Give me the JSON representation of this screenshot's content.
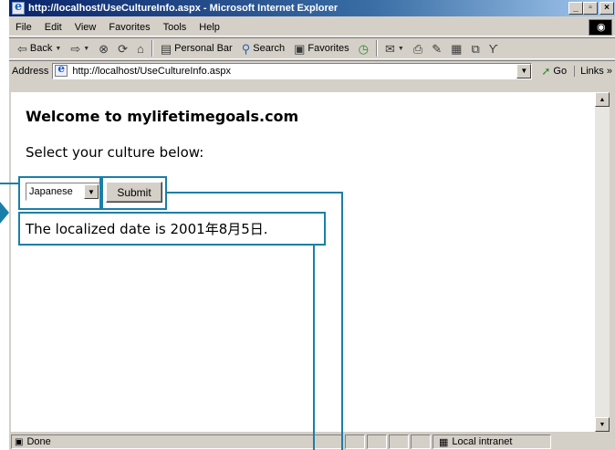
{
  "window": {
    "title": "http://localhost/UseCultureInfo.aspx - Microsoft Internet Explorer"
  },
  "menu": [
    "File",
    "Edit",
    "View",
    "Favorites",
    "Tools",
    "Help"
  ],
  "toolbar": {
    "back": "Back",
    "personal_bar": "Personal Bar",
    "search": "Search",
    "favorites": "Favorites"
  },
  "address": {
    "label": "Address",
    "url": "http://localhost/UseCultureInfo.aspx",
    "go": "Go",
    "links": "Links"
  },
  "page": {
    "heading": "Welcome to mylifetimegoals.com",
    "prompt": "Select your culture below:",
    "culture_selected": "Japanese",
    "submit_label": "Submit",
    "result": "The localized date is 2001年8月5日."
  },
  "status": {
    "text": "Done",
    "zone": "Local intranet"
  },
  "colors": {
    "callout": "#1a7fa8",
    "titlebar": "#0a246a"
  }
}
